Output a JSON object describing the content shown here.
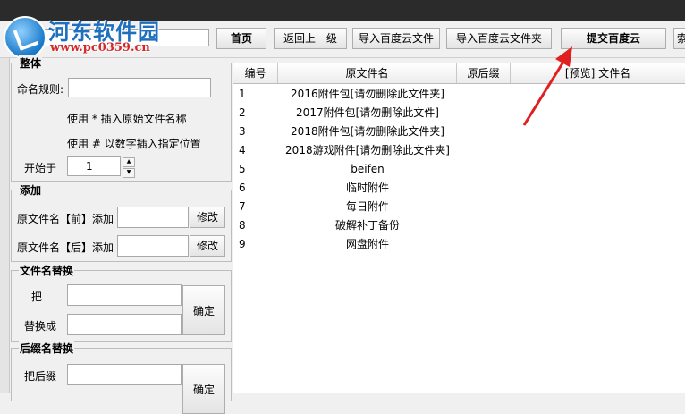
{
  "watermark": {
    "site_name": "河东软件园",
    "url": "www.pc0359.cn"
  },
  "toolbar": {
    "home": "首页",
    "back": "返回上一级",
    "import_file": "导入百度云文件",
    "import_folder": "导入百度云文件夹",
    "submit": "提交百度云",
    "extra": "索"
  },
  "panel": {
    "overall": {
      "title": "整体",
      "rule_label": "命名规则:",
      "hint1": "使用 * 插入原始文件名称",
      "hint2": "使用 # 以数字插入指定位置",
      "start_label": "开始于",
      "start_value": "1"
    },
    "add": {
      "title": "添加",
      "prefix_label": "原文件名【前】添加",
      "prefix_btn": "修改",
      "suffix_label": "原文件名【后】添加",
      "suffix_btn": "修改"
    },
    "replace": {
      "title": "文件名替换",
      "find_label": "把",
      "replace_label": "替换成",
      "confirm": "确定"
    },
    "ext": {
      "title": "后缀名替换",
      "find_label": "把后缀",
      "confirm": "确定"
    }
  },
  "table": {
    "headers": [
      "编号",
      "原文件名",
      "原后缀",
      "[预览] 文件名"
    ],
    "rows": [
      {
        "no": "1",
        "name": "2016附件包[请勿删除此文件夹]"
      },
      {
        "no": "2",
        "name": "2017附件包[请勿删除此文件]"
      },
      {
        "no": "3",
        "name": "2018附件包[请勿删除此文件夹]"
      },
      {
        "no": "4",
        "name": "2018游戏附件[请勿删除此文件夹]"
      },
      {
        "no": "5",
        "name": "beifen"
      },
      {
        "no": "6",
        "name": "临时附件"
      },
      {
        "no": "7",
        "name": "每日附件"
      },
      {
        "no": "8",
        "name": "破解补丁备份"
      },
      {
        "no": "9",
        "name": "网盘附件"
      }
    ]
  },
  "colors": {
    "arrow": "#e02020",
    "watermark_title": "#1f6fbf",
    "watermark_url": "#d22a2a"
  }
}
